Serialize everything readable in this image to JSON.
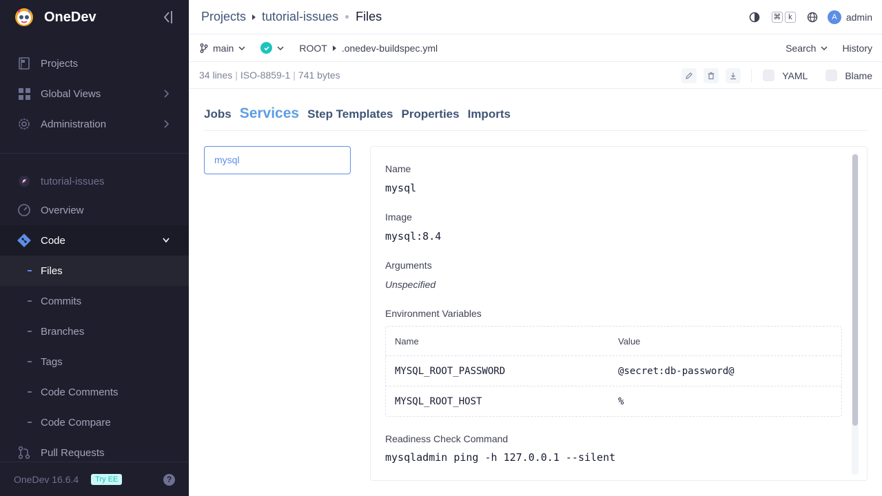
{
  "sidebar": {
    "brand": "OneDev",
    "items": [
      {
        "label": "Projects"
      },
      {
        "label": "Global Views"
      },
      {
        "label": "Administration"
      }
    ],
    "project": "tutorial-issues",
    "project_items": [
      {
        "label": "Overview"
      },
      {
        "label": "Code"
      },
      {
        "label": "Files"
      },
      {
        "label": "Commits"
      },
      {
        "label": "Branches"
      },
      {
        "label": "Tags"
      },
      {
        "label": "Code Comments"
      },
      {
        "label": "Code Compare"
      },
      {
        "label": "Pull Requests"
      }
    ],
    "footer": {
      "version": "OneDev 16.6.4",
      "try_ee": "Try EE",
      "help": "?"
    }
  },
  "topbar": {
    "breadcrumb": [
      "Projects",
      "tutorial-issues",
      "Files"
    ],
    "kbd": [
      "⌘",
      "k"
    ],
    "user": "admin",
    "user_initial": "A"
  },
  "revbar": {
    "branch": "main",
    "path_root": "ROOT",
    "path_file": ".onedev-buildspec.yml",
    "search": "Search",
    "history": "History"
  },
  "infobar": {
    "lines": "34 lines",
    "encoding": "ISO-8859-1",
    "size": "741 bytes",
    "yaml": "YAML",
    "blame": "Blame"
  },
  "tabs": [
    {
      "label": "Jobs"
    },
    {
      "label": "Services",
      "active": true
    },
    {
      "label": "Step Templates"
    },
    {
      "label": "Properties"
    },
    {
      "label": "Imports"
    }
  ],
  "service_list": {
    "selected": "mysql"
  },
  "detail": {
    "name_label": "Name",
    "name_value": "mysql",
    "image_label": "Image",
    "image_value": "mysql:8.4",
    "args_label": "Arguments",
    "args_value": "Unspecified",
    "env_label": "Environment Variables",
    "env_headers": [
      "Name",
      "Value"
    ],
    "env_rows": [
      {
        "name": "MYSQL_ROOT_PASSWORD",
        "value": "@secret:db-password@"
      },
      {
        "name": "MYSQL_ROOT_HOST",
        "value": "%"
      }
    ],
    "readiness_label": "Readiness Check Command",
    "readiness_value": "mysqladmin ping -h 127.0.0.1 --silent"
  },
  "colors": {
    "accent": "#5d8ee6",
    "sidebar_bg": "#1e1e2d",
    "success": "#1bc5bd"
  }
}
